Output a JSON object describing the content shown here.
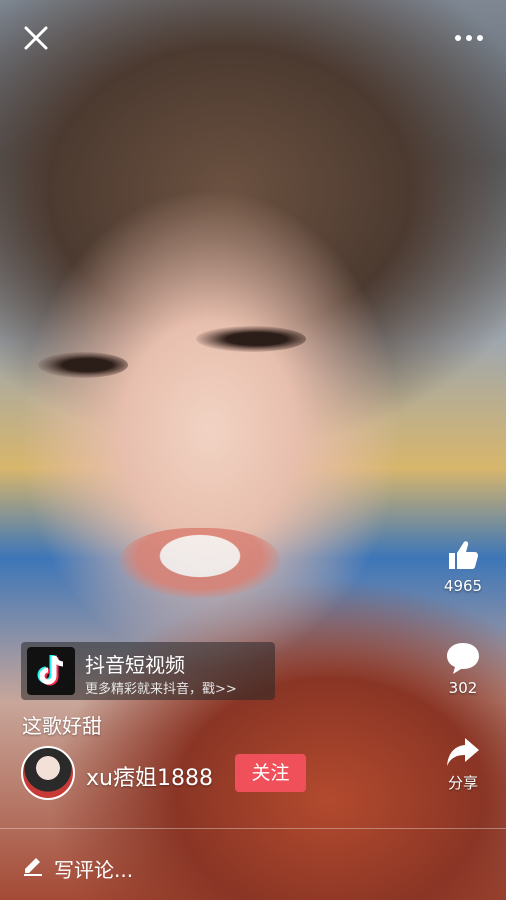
{
  "top_bar": {
    "close_icon": "close-icon",
    "more_icon": "more-options-icon"
  },
  "actions": {
    "like": {
      "icon": "thumbs-up-icon",
      "count": "4965"
    },
    "comment": {
      "icon": "comment-bubble-icon",
      "count": "302"
    },
    "share": {
      "icon": "share-arrow-icon",
      "label": "分享"
    }
  },
  "promo": {
    "logo_icon": "douyin-logo-icon",
    "title": "抖音短视频",
    "subtitle": "更多精彩就来抖音，戳>>"
  },
  "caption": "这歌好甜",
  "author": {
    "name": "xu痞姐1888",
    "follow_label": "关注"
  },
  "comment_bar": {
    "icon": "pencil-icon",
    "placeholder": "写评论..."
  },
  "colors": {
    "follow_button": "#f0505a",
    "text": "#ffffff"
  }
}
